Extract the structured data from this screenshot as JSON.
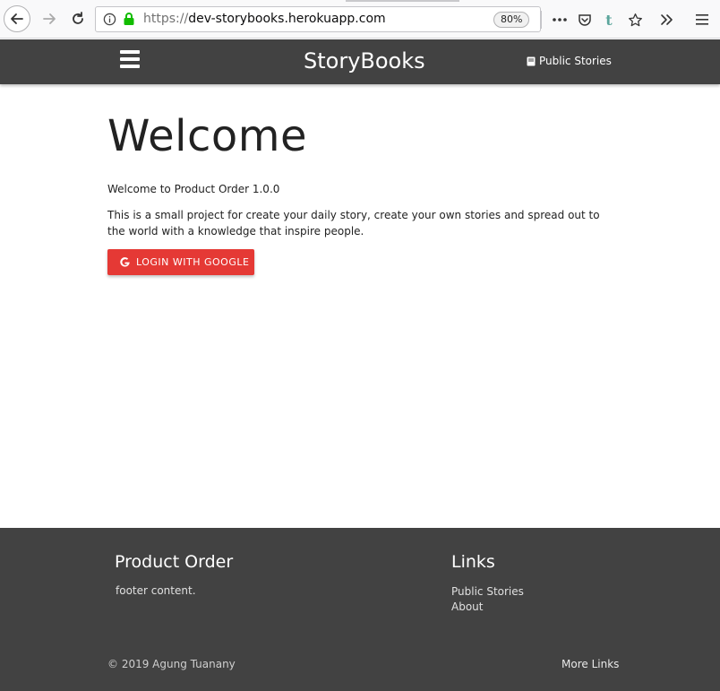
{
  "browser": {
    "url_scheme": "https://",
    "url_host": "dev-storybooks.herokuapp.com",
    "zoom": "80%",
    "icons": [
      "back-arrow-icon",
      "forward-arrow-icon",
      "reload-icon",
      "info-icon",
      "lock-icon",
      "more-icon",
      "pocket-icon",
      "tumblr-icon",
      "star-icon",
      "overflow-icon",
      "menu-icon"
    ]
  },
  "nav": {
    "brand": "StoryBooks",
    "public_stories": "Public Stories"
  },
  "main": {
    "title": "Welcome",
    "intro": "Welcome to Product Order 1.0.0",
    "description": "This is a small project for create your daily story, create your own stories and spread out to the world with a knowledge that inspire people.",
    "login_button": "LOGIN WITH GOOGLE"
  },
  "footer": {
    "left_title": "Product Order",
    "left_content": "footer content.",
    "right_title": "Links",
    "links": [
      "Public Stories",
      "About"
    ],
    "copyright": "© 2019 Agung Tuanany",
    "more_links": "More Links"
  },
  "colors": {
    "navbar": "#424242",
    "google_button": "#e53935"
  }
}
